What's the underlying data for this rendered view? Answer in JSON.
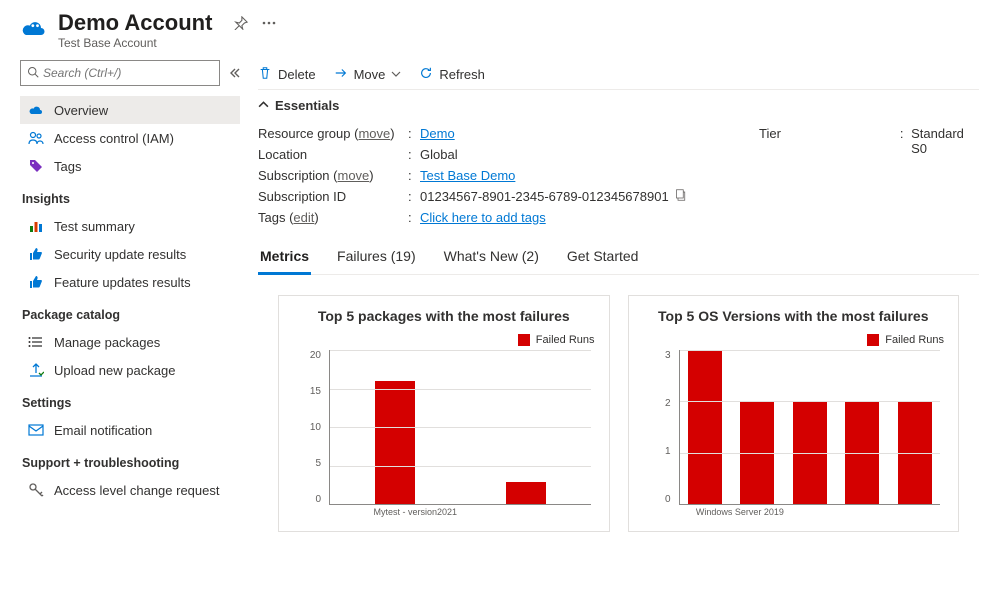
{
  "header": {
    "title": "Demo Account",
    "subtitle": "Test Base Account"
  },
  "search": {
    "placeholder": "Search (Ctrl+/)"
  },
  "nav": {
    "top": [
      {
        "label": "Overview",
        "icon": "cloud",
        "active": true
      },
      {
        "label": "Access control (IAM)",
        "icon": "people"
      },
      {
        "label": "Tags",
        "icon": "tag"
      }
    ],
    "sections": [
      {
        "title": "Insights",
        "items": [
          {
            "label": "Test summary",
            "icon": "bars"
          },
          {
            "label": "Security update results",
            "icon": "thumb-blue"
          },
          {
            "label": "Feature updates results",
            "icon": "thumb-blue"
          }
        ]
      },
      {
        "title": "Package catalog",
        "items": [
          {
            "label": "Manage packages",
            "icon": "list"
          },
          {
            "label": "Upload new package",
            "icon": "upload"
          }
        ]
      },
      {
        "title": "Settings",
        "items": [
          {
            "label": "Email notification",
            "icon": "mail"
          }
        ]
      },
      {
        "title": "Support + troubleshooting",
        "items": [
          {
            "label": "Access level change request",
            "icon": "key"
          }
        ]
      }
    ]
  },
  "toolbar": {
    "delete": "Delete",
    "move": "Move",
    "refresh": "Refresh"
  },
  "essentials": {
    "header": "Essentials",
    "rows_left": [
      {
        "label": "Resource group",
        "sublink": "move",
        "value": "Demo",
        "link": true
      },
      {
        "label": "Location",
        "value": "Global"
      },
      {
        "label": "Subscription",
        "sublink": "move",
        "value": "Test Base Demo",
        "link": true
      },
      {
        "label": "Subscription ID",
        "value": "01234567-8901-2345-6789-012345678901",
        "copy": true
      },
      {
        "label": "Tags",
        "sublink": "edit",
        "value": "Click here to add tags",
        "link": true
      }
    ],
    "rows_right": [
      {
        "label": "Tier",
        "value": "Standard S0"
      }
    ]
  },
  "tabs": [
    {
      "label": "Metrics",
      "active": true
    },
    {
      "label": "Failures (19)"
    },
    {
      "label": "What's New (2)"
    },
    {
      "label": "Get Started"
    }
  ],
  "charts": {
    "legend": "Failed Runs",
    "left": {
      "title": "Top 5 packages with the most failures"
    },
    "right": {
      "title": "Top 5 OS Versions with the most failures"
    }
  },
  "chart_data": [
    {
      "type": "bar",
      "title": "Top 5 packages with the most failures",
      "series_name": "Failed Runs",
      "categories": [
        "Mytest - version2021",
        ""
      ],
      "values": [
        16,
        3
      ],
      "ylim": [
        0,
        20
      ],
      "yticks": [
        0,
        5,
        10,
        15,
        20
      ],
      "xlabel": "",
      "ylabel": ""
    },
    {
      "type": "bar",
      "title": "Top 5 OS Versions with the most failures",
      "series_name": "Failed Runs",
      "categories": [
        "Windows Server 2019",
        "",
        "",
        "",
        ""
      ],
      "values": [
        3,
        2,
        2,
        2,
        2
      ],
      "ylim": [
        0,
        3
      ],
      "yticks": [
        0,
        1,
        2,
        3
      ],
      "xlabel": "",
      "ylabel": ""
    }
  ]
}
